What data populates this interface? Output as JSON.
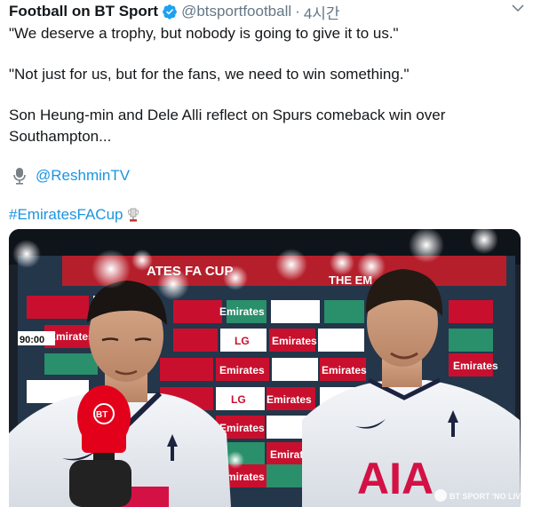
{
  "tweet": {
    "display_name": "Football on BT Sport",
    "handle": "@btsportfootball",
    "separator": "·",
    "time": "4시간",
    "quote1": "\"We deserve a trophy, but nobody is going to give it to us.\"",
    "quote2": "\"Not just for us, but for the fans, we need to win something.\"",
    "body": "Son Heung-min and Dele Alli reflect on Spurs comeback win over Southampton...",
    "mention": "@ReshminTV",
    "hashtag": "#EmiratesFACup"
  },
  "media": {
    "board_logos": [
      "Emirates",
      "Emirates",
      "Emirates",
      "Emirates",
      "Emirates",
      "Emirates",
      "Emirates",
      "Emirates",
      "Emirates",
      "Emirates",
      "LG",
      "LG"
    ],
    "board_title": "ATES FA CUP",
    "board_title_right": "THE EM",
    "scoreboard": "90:00",
    "shirt_sponsor": "AIA",
    "mic_logo": "BT",
    "watermark": "BT SPORT 'NO LIVE'"
  },
  "colors": {
    "link": "#1b95e0",
    "verified": "#1da1f2",
    "muted": "#657786",
    "bt_red": "#e3001b",
    "emirates_red": "#c8102e",
    "aia_red": "#d31145"
  },
  "icons": {
    "verified": "verified-badge-icon",
    "caret": "chevron-down-icon",
    "mic": "microphone-icon",
    "trophy": "trophy-emoji-icon"
  }
}
